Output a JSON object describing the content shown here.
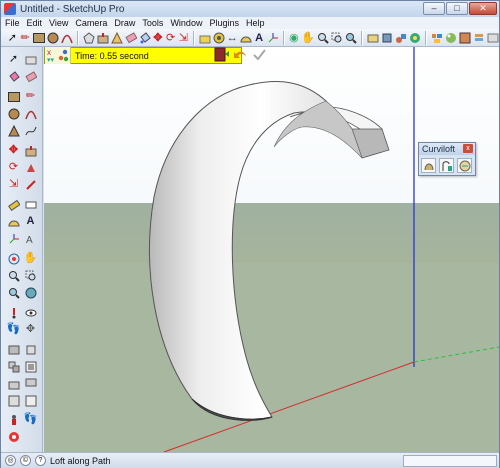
{
  "window": {
    "title": "Untitled - SketchUp Pro",
    "controls": {
      "minimize": "–",
      "maximize": "□",
      "close": "✕"
    }
  },
  "menu": [
    "File",
    "Edit",
    "View",
    "Camera",
    "Draw",
    "Tools",
    "Window",
    "Plugins",
    "Help"
  ],
  "top_toolbar": [
    "select-tool-icon",
    "pencil-icon",
    "rectangle-icon",
    "circle-icon",
    "arc-icon",
    "polygon-icon",
    "push-pull-icon",
    "offset-icon",
    "eraser-icon",
    "paint-bucket-icon",
    "move-icon",
    "rotate-icon",
    "scale-icon",
    "follow-me-icon",
    "tape-measure-icon",
    "dimension-icon",
    "protractor-icon",
    "text-icon",
    "axes-icon",
    "orbit-icon",
    "pan-icon",
    "zoom-icon",
    "zoom-window-icon",
    "zoom-extents-icon",
    "previous-view-icon",
    "next-view-icon",
    "get-models-icon",
    "share-model-icon",
    "get-photo-texture-icon",
    "share-component-icon",
    "components-icon",
    "materials-icon",
    "styles-icon",
    "layers-icon",
    "extension-icon"
  ],
  "measurement": {
    "text": "Time: 0.55 second",
    "icons": [
      "close-x-icon",
      "expand-arrow-icon",
      "color-dots-icon"
    ]
  },
  "loft_actions": [
    "exit-door-icon",
    "undo-loft-icon",
    "confirm-check-icon"
  ],
  "palette": {
    "title": "Curviloft",
    "close": "x",
    "tools": [
      "loft-by-spline-icon",
      "loft-along-path-icon",
      "skin-contour-icon"
    ]
  },
  "status": {
    "text": "Loft along Path",
    "icons": [
      "geo-location-icon",
      "credits-icon",
      "help-icon"
    ]
  },
  "colors": {
    "measure_bar": "#ffff00",
    "ground": "#a7b7a0",
    "sky_top": "#ffffff",
    "axis_blue": "#2b33d6",
    "axis_red": "#d62b2b",
    "axis_green": "#2bbf43"
  }
}
